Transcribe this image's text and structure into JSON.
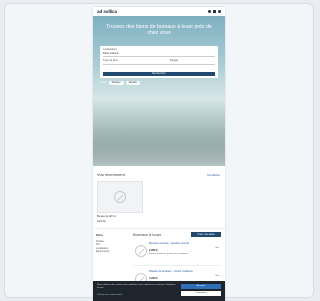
{
  "header": {
    "logo_text": "ad sollica",
    "icons": [
      "favorite-icon",
      "user-icon",
      "menu-icon"
    ]
  },
  "hero": {
    "title": "Trouvez des biens de bureaux à louer près de chez vous",
    "search": {
      "label_location": "Localisation",
      "value_location": "Paris, France",
      "label_type": "Type de bien",
      "label_budget": "Budget",
      "submit_label": "Rechercher"
    },
    "toggle": {
      "label_a": "Louer",
      "label_b": "Acheter",
      "label_c": "Vendre"
    }
  },
  "recent": {
    "title": "Vus récemment",
    "link": "Tout afficher",
    "card_title": "Bureau de 120 m²",
    "card_sub": "Paris 8e"
  },
  "results": {
    "filters_title": "Filtres",
    "filters": [
      "Surface",
      "Prix",
      "Localisation",
      "Équipements"
    ],
    "title": "Bureaux à louer",
    "create_alert": "Créer une alerte",
    "listings": [
      {
        "title": "Bureaux rénovés - Quartier central",
        "price": "2 850 €",
        "desc": "Espace lumineux, proche des transports",
        "side": "Voir"
      },
      {
        "title": "Plateau de bureaux - Centre d'affaires",
        "price": "4 200 €",
        "desc": "Open space modulable avec salles de réunion",
        "side": "Voir"
      }
    ]
  },
  "cookie": {
    "text": "Nous utilisons des cookies pour améliorer votre expérience et mesurer l'audience du site.",
    "accept": "Accepter",
    "manage": "Paramétrer",
    "links": "Politique de confidentialité"
  },
  "colors": {
    "accent": "#20496f",
    "link": "#1f5aa6",
    "cookie_bg": "#1f252c"
  }
}
